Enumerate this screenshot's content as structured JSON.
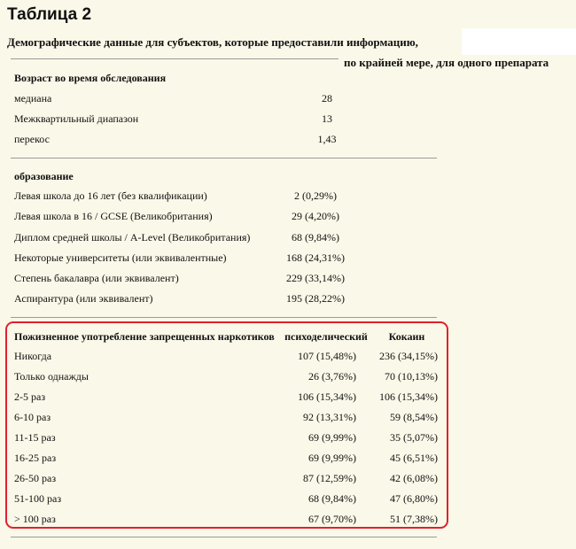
{
  "header": {
    "title": "Таблица 2",
    "subtitle_line1": "Демографические данные для субъектов, которые предоставили информацию,",
    "subtitle_line2": "по крайней мере, для одного препарата"
  },
  "age": {
    "heading": "Возраст во время обследования",
    "rows": [
      {
        "label": "медиана",
        "value": "28"
      },
      {
        "label": "Межквартильный диапазон",
        "value": "13"
      },
      {
        "label": "перекос",
        "value": "1,43"
      }
    ]
  },
  "education": {
    "heading": "образование",
    "rows": [
      {
        "label": "Левая школа до 16 лет (без квалификации)",
        "value": "2 (0,29%)"
      },
      {
        "label": "Левая школа в 16 / GCSE (Великобритания)",
        "value": "29 (4,20%)"
      },
      {
        "label": "Диплом средней школы / A-Level (Великобритания)",
        "value": "68 (9,84%)"
      },
      {
        "label": "Некоторые университеты (или эквивалентные)",
        "value": "168 (24,31%)"
      },
      {
        "label": "Степень бакалавра (или эквивалент)",
        "value": "229 (33,14%)"
      },
      {
        "label": "Аспирантура (или эквивалент)",
        "value": "195 (28,22%)"
      }
    ]
  },
  "drugs": {
    "heading": "Пожизненное употребление запрещенных наркотиков",
    "col_psychedelic": "психоделический",
    "col_cocaine": "Кокаин",
    "rows": [
      {
        "label": "Никогда",
        "psychedelic": "107 (15,48%)",
        "cocaine": "236 (34,15%)"
      },
      {
        "label": "Только однажды",
        "psychedelic": "26 (3,76%)",
        "cocaine": "70 (10,13%)"
      },
      {
        "label": "2-5 раз",
        "psychedelic": "106 (15,34%)",
        "cocaine": "106 (15,34%)"
      },
      {
        "label": "6-10 раз",
        "psychedelic": "92 (13,31%)",
        "cocaine": "59 (8,54%)"
      },
      {
        "label": "11-15 раз",
        "psychedelic": "69 (9,99%)",
        "cocaine": "35 (5,07%)"
      },
      {
        "label": "16-25 раз",
        "psychedelic": "69 (9,99%)",
        "cocaine": "45 (6,51%)"
      },
      {
        "label": "26-50 раз",
        "psychedelic": "87 (12,59%)",
        "cocaine": "42 (6,08%)"
      },
      {
        "label": "51-100 раз",
        "psychedelic": "68 (9,84%)",
        "cocaine": "47 (6,80%)"
      },
      {
        "label": "> 100 раз",
        "psychedelic": "67 (9,70%)",
        "cocaine": "51 (7,38%)"
      }
    ]
  }
}
